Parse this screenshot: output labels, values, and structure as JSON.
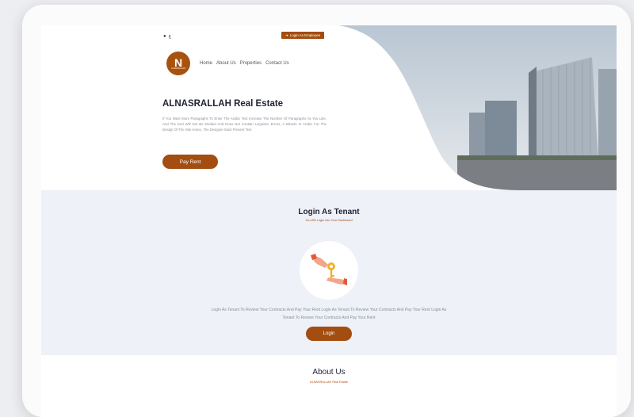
{
  "header": {
    "lang_label": "ع",
    "login_employee": "Login As Employee",
    "logo_letter": "N",
    "logo_text": "ALNASRALLAH"
  },
  "nav": {
    "items": [
      {
        "label": "Home"
      },
      {
        "label": "About Us"
      },
      {
        "label": "Properties"
      },
      {
        "label": "Contact Us"
      }
    ]
  },
  "hero": {
    "title": "ALNASRALLAH Real Estate",
    "paragraph": "If You Want More Paragraphs To Enter The Arabic Text Increase The Number Of Paragraphs As You Like, And The End Will Not Be Divided And Does Not Contain Linguistic Errors, A Miracle In Arabic For The Design Of The Site Home, The Designer Must Present Text",
    "pay_rent_label": "Pay Rent"
  },
  "tenant": {
    "title": "Login As Tenant",
    "subtitle": "You Will Login Into Your Dashboard",
    "description": "Login As Tenant To Review Your Contracts And Pay Your Rent Login As Tenant To Review Your Contracts And Pay Your Rent Login As Tenant To Review Your Contracts And Pay Your Rent",
    "login_label": "Login"
  },
  "about": {
    "title": "About Us",
    "subtitle": "ALNASRALLAH Real Estate"
  },
  "colors": {
    "accent": "#a34d10",
    "section_bg": "#eef1f7",
    "title_text": "#1f2230"
  }
}
